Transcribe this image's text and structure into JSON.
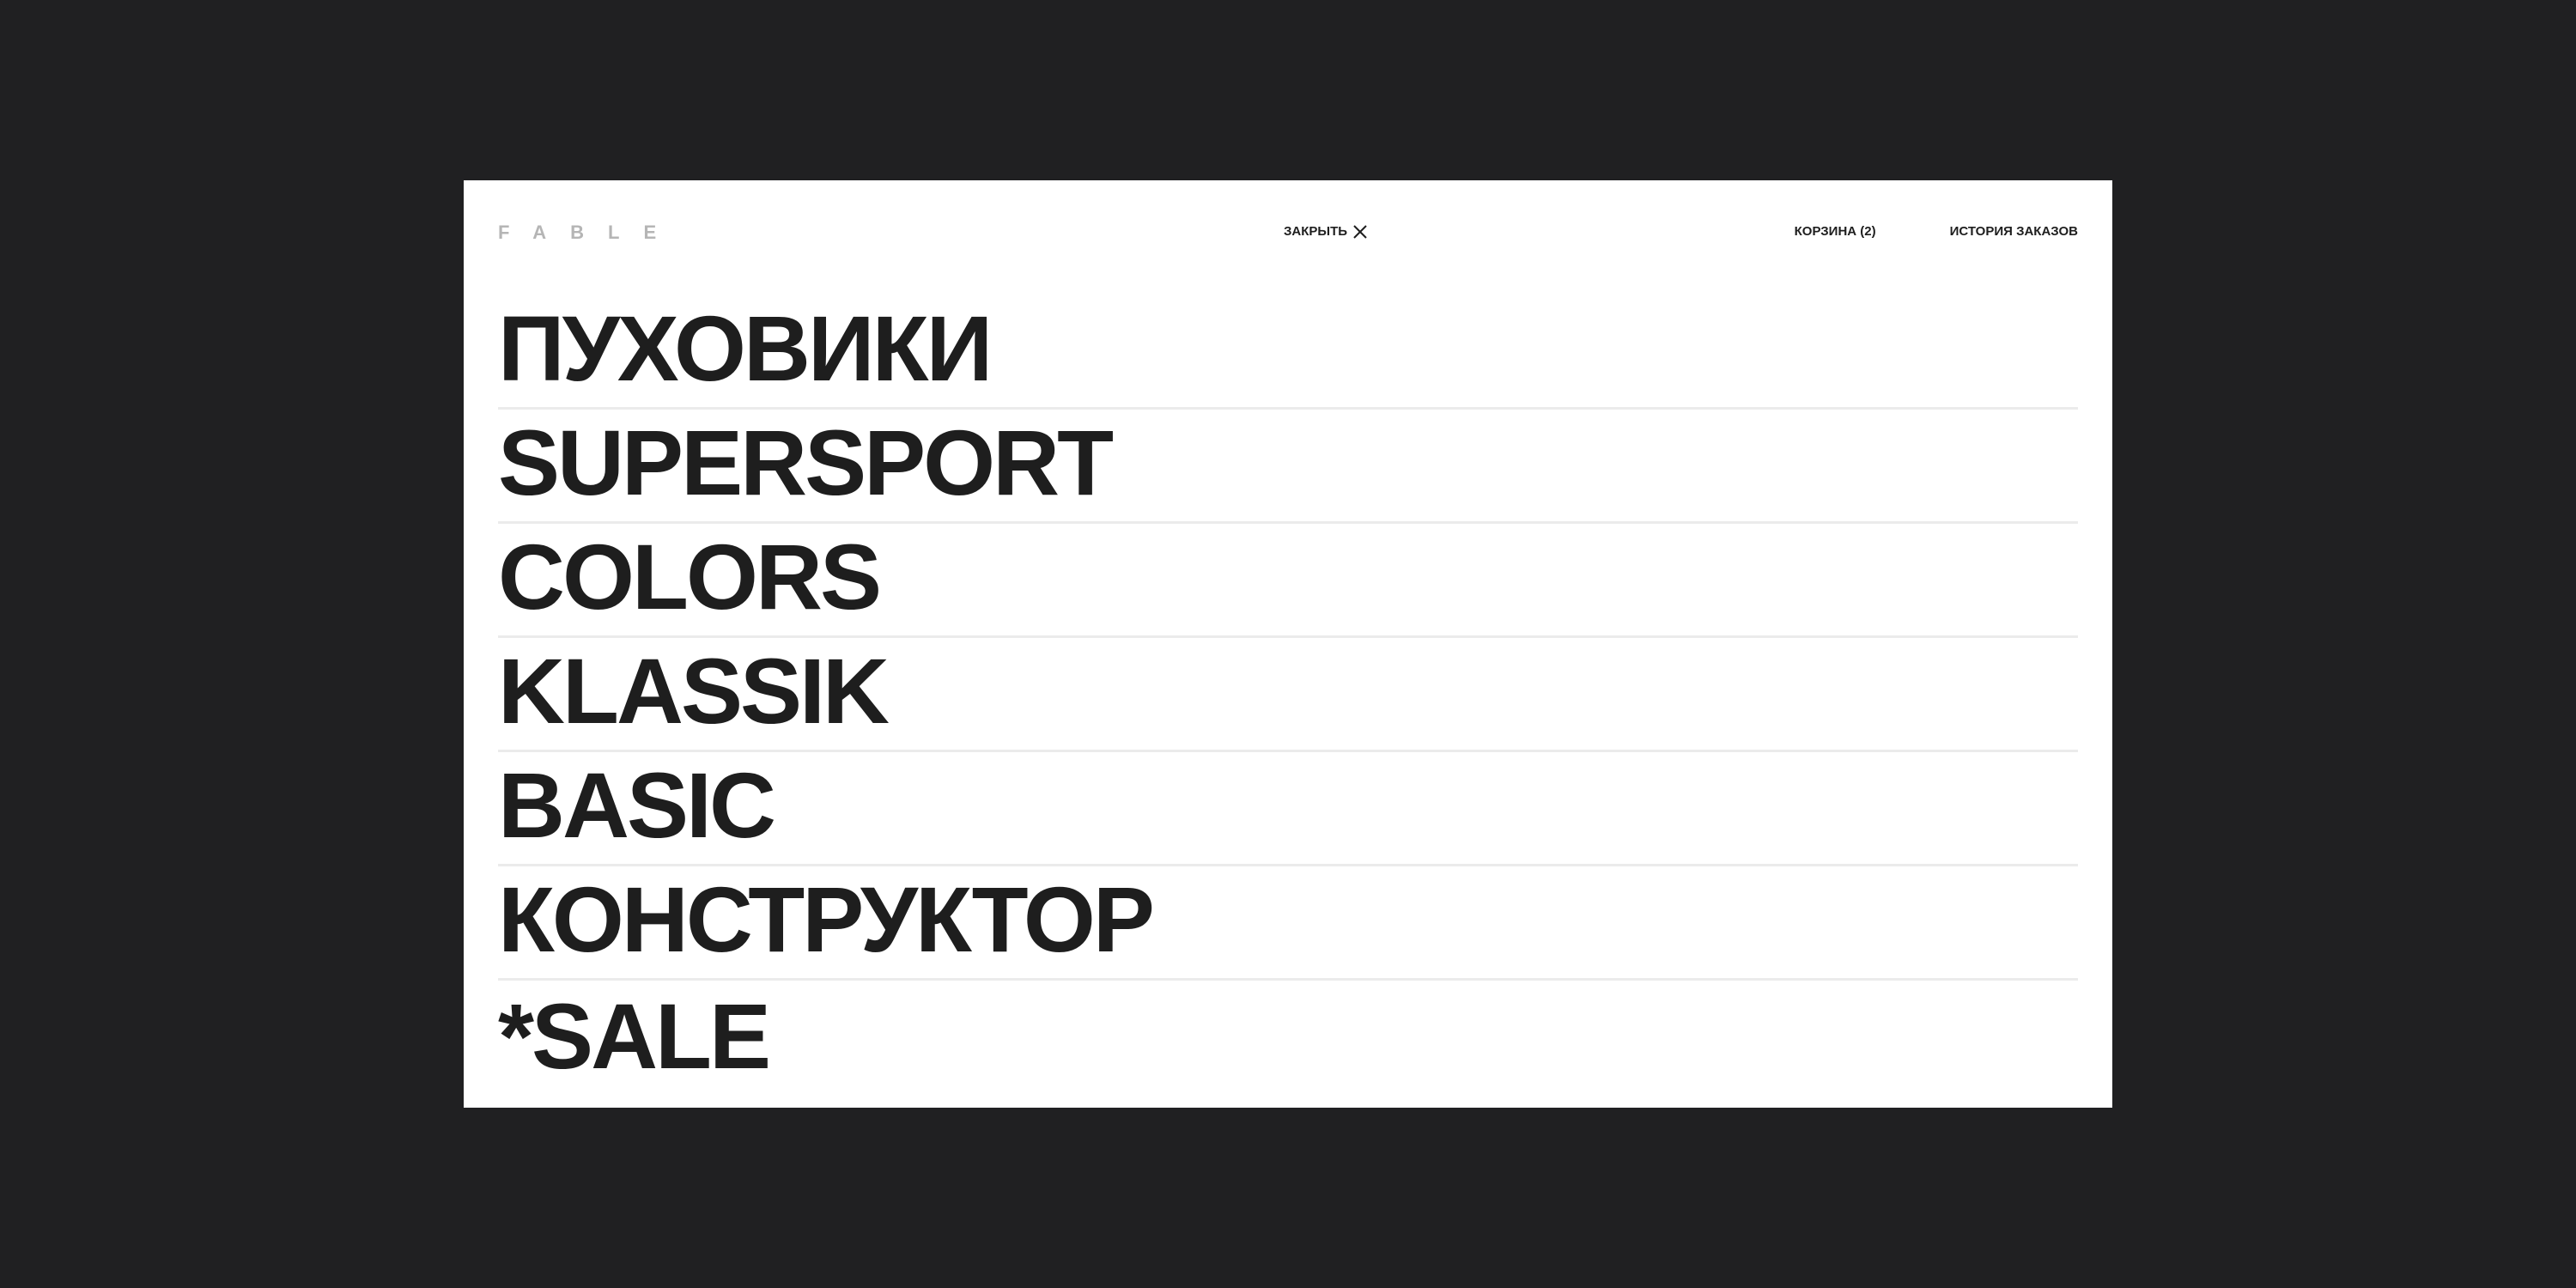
{
  "header": {
    "logo": "FABLE",
    "close_label": "ЗАКРЫТЬ",
    "close_icon": "close-icon",
    "cart_label": "КОРЗИНА (2)",
    "history_label": "ИСТОРИЯ ЗАКАЗОВ"
  },
  "menu": {
    "items": [
      {
        "label": "ПУХОВИКИ"
      },
      {
        "label": "SUPERSPORT"
      },
      {
        "label": "COLORS"
      },
      {
        "label": "KLASSIK"
      },
      {
        "label": "BASIC"
      },
      {
        "label": "КОНСТРУКТОР"
      },
      {
        "label": "*SALE"
      }
    ]
  },
  "colors": {
    "background": "#202022",
    "panel": "#ffffff",
    "text": "#1e1e1e",
    "logo": "#b5b5b5",
    "divider": "#ebebeb"
  }
}
